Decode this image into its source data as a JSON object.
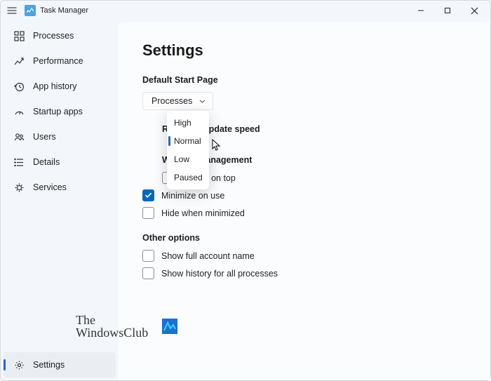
{
  "app": {
    "title": "Task Manager"
  },
  "sidebar": {
    "items": [
      {
        "label": "Processes"
      },
      {
        "label": "Performance"
      },
      {
        "label": "App history"
      },
      {
        "label": "Startup apps"
      },
      {
        "label": "Users"
      },
      {
        "label": "Details"
      },
      {
        "label": "Services"
      }
    ],
    "footer": {
      "label": "Settings"
    }
  },
  "content": {
    "heading": "Settings",
    "startPage": {
      "label": "Default Start Page",
      "value": "Processes"
    },
    "speed": {
      "label": "Real time update speed",
      "options": [
        "High",
        "Normal",
        "Low",
        "Paused"
      ],
      "selected": "Normal"
    },
    "winMgmt": {
      "label": "Window management",
      "opts": [
        {
          "label": "Always on top",
          "checked": false
        },
        {
          "label": "Minimize on use",
          "checked": true
        },
        {
          "label": "Hide when minimized",
          "checked": false
        }
      ]
    },
    "other": {
      "label": "Other options",
      "opts": [
        {
          "label": "Show full account name",
          "checked": false
        },
        {
          "label": "Show history for all processes",
          "checked": false
        }
      ]
    }
  },
  "watermark": {
    "line1": "The",
    "line2": "WindowsClub"
  }
}
